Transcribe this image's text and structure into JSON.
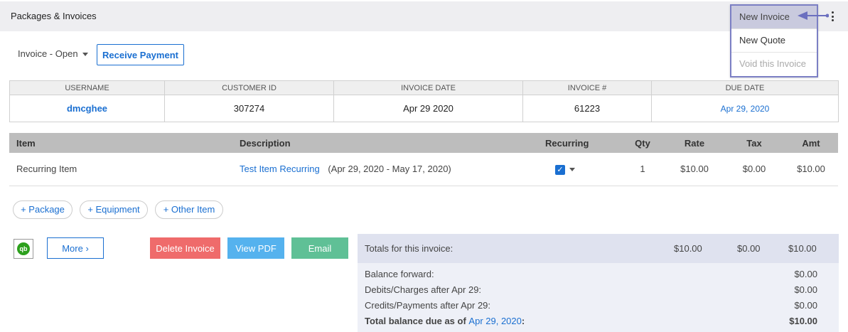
{
  "header": {
    "title": "Packages & Invoices"
  },
  "menu": {
    "items": [
      "New Invoice",
      "New Quote",
      "Void this Invoice"
    ]
  },
  "toolbar": {
    "status": "Invoice - Open",
    "receive_payment": "Receive Payment"
  },
  "info": {
    "headers": [
      "USERNAME",
      "CUSTOMER ID",
      "INVOICE DATE",
      "INVOICE #",
      "DUE DATE"
    ],
    "username": "dmcghee",
    "customer_id": "307274",
    "invoice_date": "Apr 29 2020",
    "invoice_no": "61223",
    "due_date": "Apr 29, 2020"
  },
  "items": {
    "headers": [
      "Item",
      "Description",
      "Recurring",
      "Qty",
      "Rate",
      "Tax",
      "Amt"
    ],
    "rows": [
      {
        "item": "Recurring Item",
        "desc_link": "Test Item Recurring",
        "desc_period": "(Apr 29, 2020 - May 17, 2020)",
        "recurring": true,
        "qty": "1",
        "rate": "$10.00",
        "tax": "$0.00",
        "amt": "$10.00"
      }
    ]
  },
  "add_buttons": [
    "+ Package",
    "+ Equipment",
    "+ Other Item"
  ],
  "actions": {
    "qb": "qb",
    "more": "More",
    "delete": "Delete Invoice",
    "view_pdf": "View PDF",
    "email": "Email"
  },
  "totals": {
    "label": "Totals for this invoice:",
    "amt": "$10.00",
    "tax": "$0.00",
    "total": "$10.00",
    "balance_forward_label": "Balance forward:",
    "balance_forward": "$0.00",
    "debits_label": "Debits/Charges after Apr 29:",
    "debits": "$0.00",
    "credits_label": "Credits/Payments after Apr 29:",
    "credits": "$0.00",
    "total_due_label": "Total balance due as of",
    "total_due_date": "Apr 29, 2020",
    "total_due": "$10.00"
  },
  "colors": {
    "accent": "#1a6fd1",
    "delete": "#ef6b6b",
    "pdf": "#55b2ee",
    "email": "#5fc096",
    "menu_highlight": "#c9cade"
  }
}
